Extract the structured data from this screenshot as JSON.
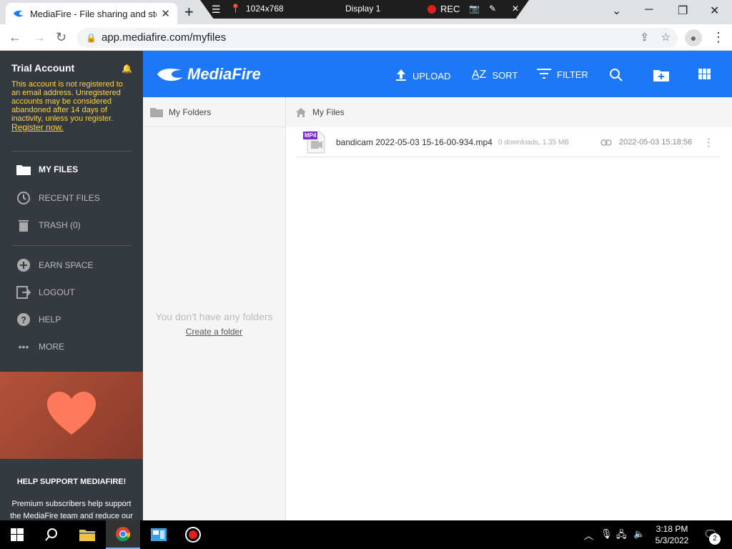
{
  "browser": {
    "tab_title": "MediaFire - File sharing and storage",
    "url": "app.mediafire.com/myfiles"
  },
  "recorder": {
    "resolution": "1024x768",
    "display": "Display 1",
    "rec": "REC"
  },
  "sidebar": {
    "account_title": "Trial Account",
    "warning": "This account is not registered to an email address. Unregistered accounts may be considered abandoned after 14 days of inactivity, unless you register.",
    "register_link": "Register now.",
    "items": [
      {
        "label": "MY FILES",
        "icon": "folder-icon"
      },
      {
        "label": "RECENT FILES",
        "icon": "clock-icon"
      },
      {
        "label": "TRASH (0)",
        "icon": "trash-icon"
      },
      {
        "label": "EARN SPACE",
        "icon": "plus-circle-icon"
      },
      {
        "label": "LOGOUT",
        "icon": "logout-icon"
      },
      {
        "label": "HELP",
        "icon": "help-icon"
      },
      {
        "label": "MORE",
        "icon": "more-icon"
      }
    ],
    "support_title": "HELP SUPPORT MEDIAFIRE!",
    "support_text": "Premium subscribers help support the MediaFire team and reduce our"
  },
  "header": {
    "brand": "MediaFire",
    "upload": "UPLOAD",
    "sort": "SORT",
    "filter": "FILTER"
  },
  "folders": {
    "title": "My Folders",
    "empty_text": "You don't have any folders",
    "create_link": "Create a folder"
  },
  "files": {
    "breadcrumb": "My Files",
    "rows": [
      {
        "badge": "MP4",
        "name": "bandicam 2022-05-03 15-16-00-934.mp4",
        "meta": "0 downloads, 1.35 MB",
        "date": "2022-05-03 15:18:56"
      }
    ]
  },
  "taskbar": {
    "time": "3:18 PM",
    "date": "5/3/2022",
    "notifications": "2"
  },
  "colors": {
    "brand_blue": "#1c78f7",
    "sidebar_bg": "#343a40",
    "warning_yellow": "#ffd43b"
  }
}
